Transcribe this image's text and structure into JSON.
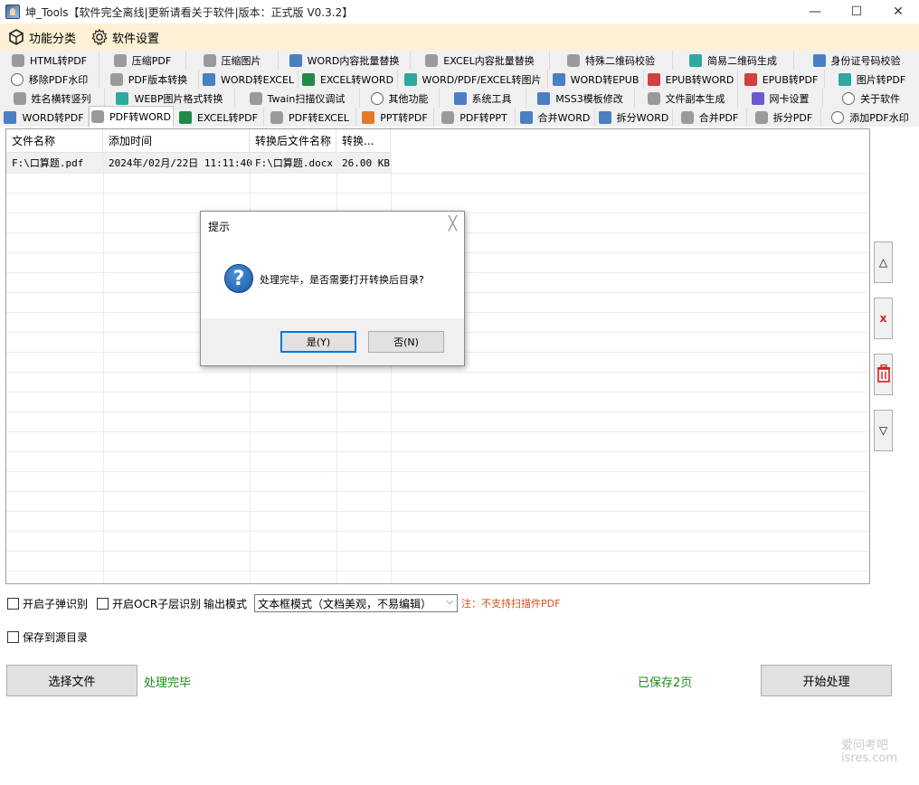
{
  "window": {
    "title": "坤_Tools【软件完全离线|更新请看关于软件|版本：正式版 V0.3.2】",
    "min": "—",
    "max": "☐",
    "close": "✕"
  },
  "menu": {
    "items": [
      {
        "label": "功能分类",
        "icon": "category-icon"
      },
      {
        "label": "软件设置",
        "icon": "gear-icon"
      }
    ]
  },
  "tabs": {
    "row1": [
      "HTML转PDF",
      "压缩PDF",
      "压缩图片",
      "WORD内容批量替换",
      "EXCEL内容批量替换",
      "特殊二维码校验",
      "简易二维码生成",
      "身份证号码校验"
    ],
    "row2": [
      "移除PDF水印",
      "PDF版本转换",
      "WORD转EXCEL",
      "EXCEL转WORD",
      "WORD/PDF/EXCEL转图片",
      "WORD转EPUB",
      "EPUB转WORD",
      "EPUB转PDF",
      "图片转PDF"
    ],
    "row3": [
      "姓名横转竖列",
      "WEBP图片格式转换",
      "Twain扫描仪调试",
      "其他功能",
      "系统工具",
      "MSS3模板修改",
      "文件副本生成",
      "网卡设置",
      "关于软件"
    ],
    "row4": [
      "WORD转PDF",
      "PDF转WORD",
      "EXCEL转PDF",
      "PDF转EXCEL",
      "PPT转PDF",
      "PDF转PPT",
      "合并WORD",
      "拆分WORD",
      "合并PDF",
      "拆分PDF",
      "添加PDF水印"
    ],
    "active": "PDF转WORD"
  },
  "table": {
    "headers": [
      "文件名称",
      "添加时间",
      "转换后文件名称",
      "转换..."
    ],
    "rows": [
      [
        "F:\\口算题.pdf",
        "2024年/02月/22日 11:11:40",
        "F:\\口算题.docx",
        "26.00 KB"
      ]
    ]
  },
  "side_buttons": [
    "△",
    "x",
    "🗑",
    "▽"
  ],
  "options": {
    "sub_bullet": "开启子弹识别",
    "ocr_layer": "开启OCR子层识别",
    "output_mode_label": "输出模式",
    "output_mode_value": "文本框模式（文档美观，不易编辑）",
    "note": "注：不支持扫描件PDF",
    "save_to_source": "保存到源目录"
  },
  "actions": {
    "select_file": "选择文件",
    "status": "处理完毕",
    "saved_pages": "已保存2页",
    "start": "开始处理"
  },
  "dialog": {
    "title": "提示",
    "close": "╳",
    "message": "处理完毕，是否需要打开转换后目录?",
    "yes": "是(Y)",
    "no": "否(N)"
  },
  "watermark": {
    "line1": "爱问考吧",
    "line2": "isres.com"
  },
  "colors": {
    "menu_bg": "#fdf0d4",
    "note": "#d24c1a",
    "status": "#1e8a1e",
    "dialog_focus": "#0078d7"
  }
}
